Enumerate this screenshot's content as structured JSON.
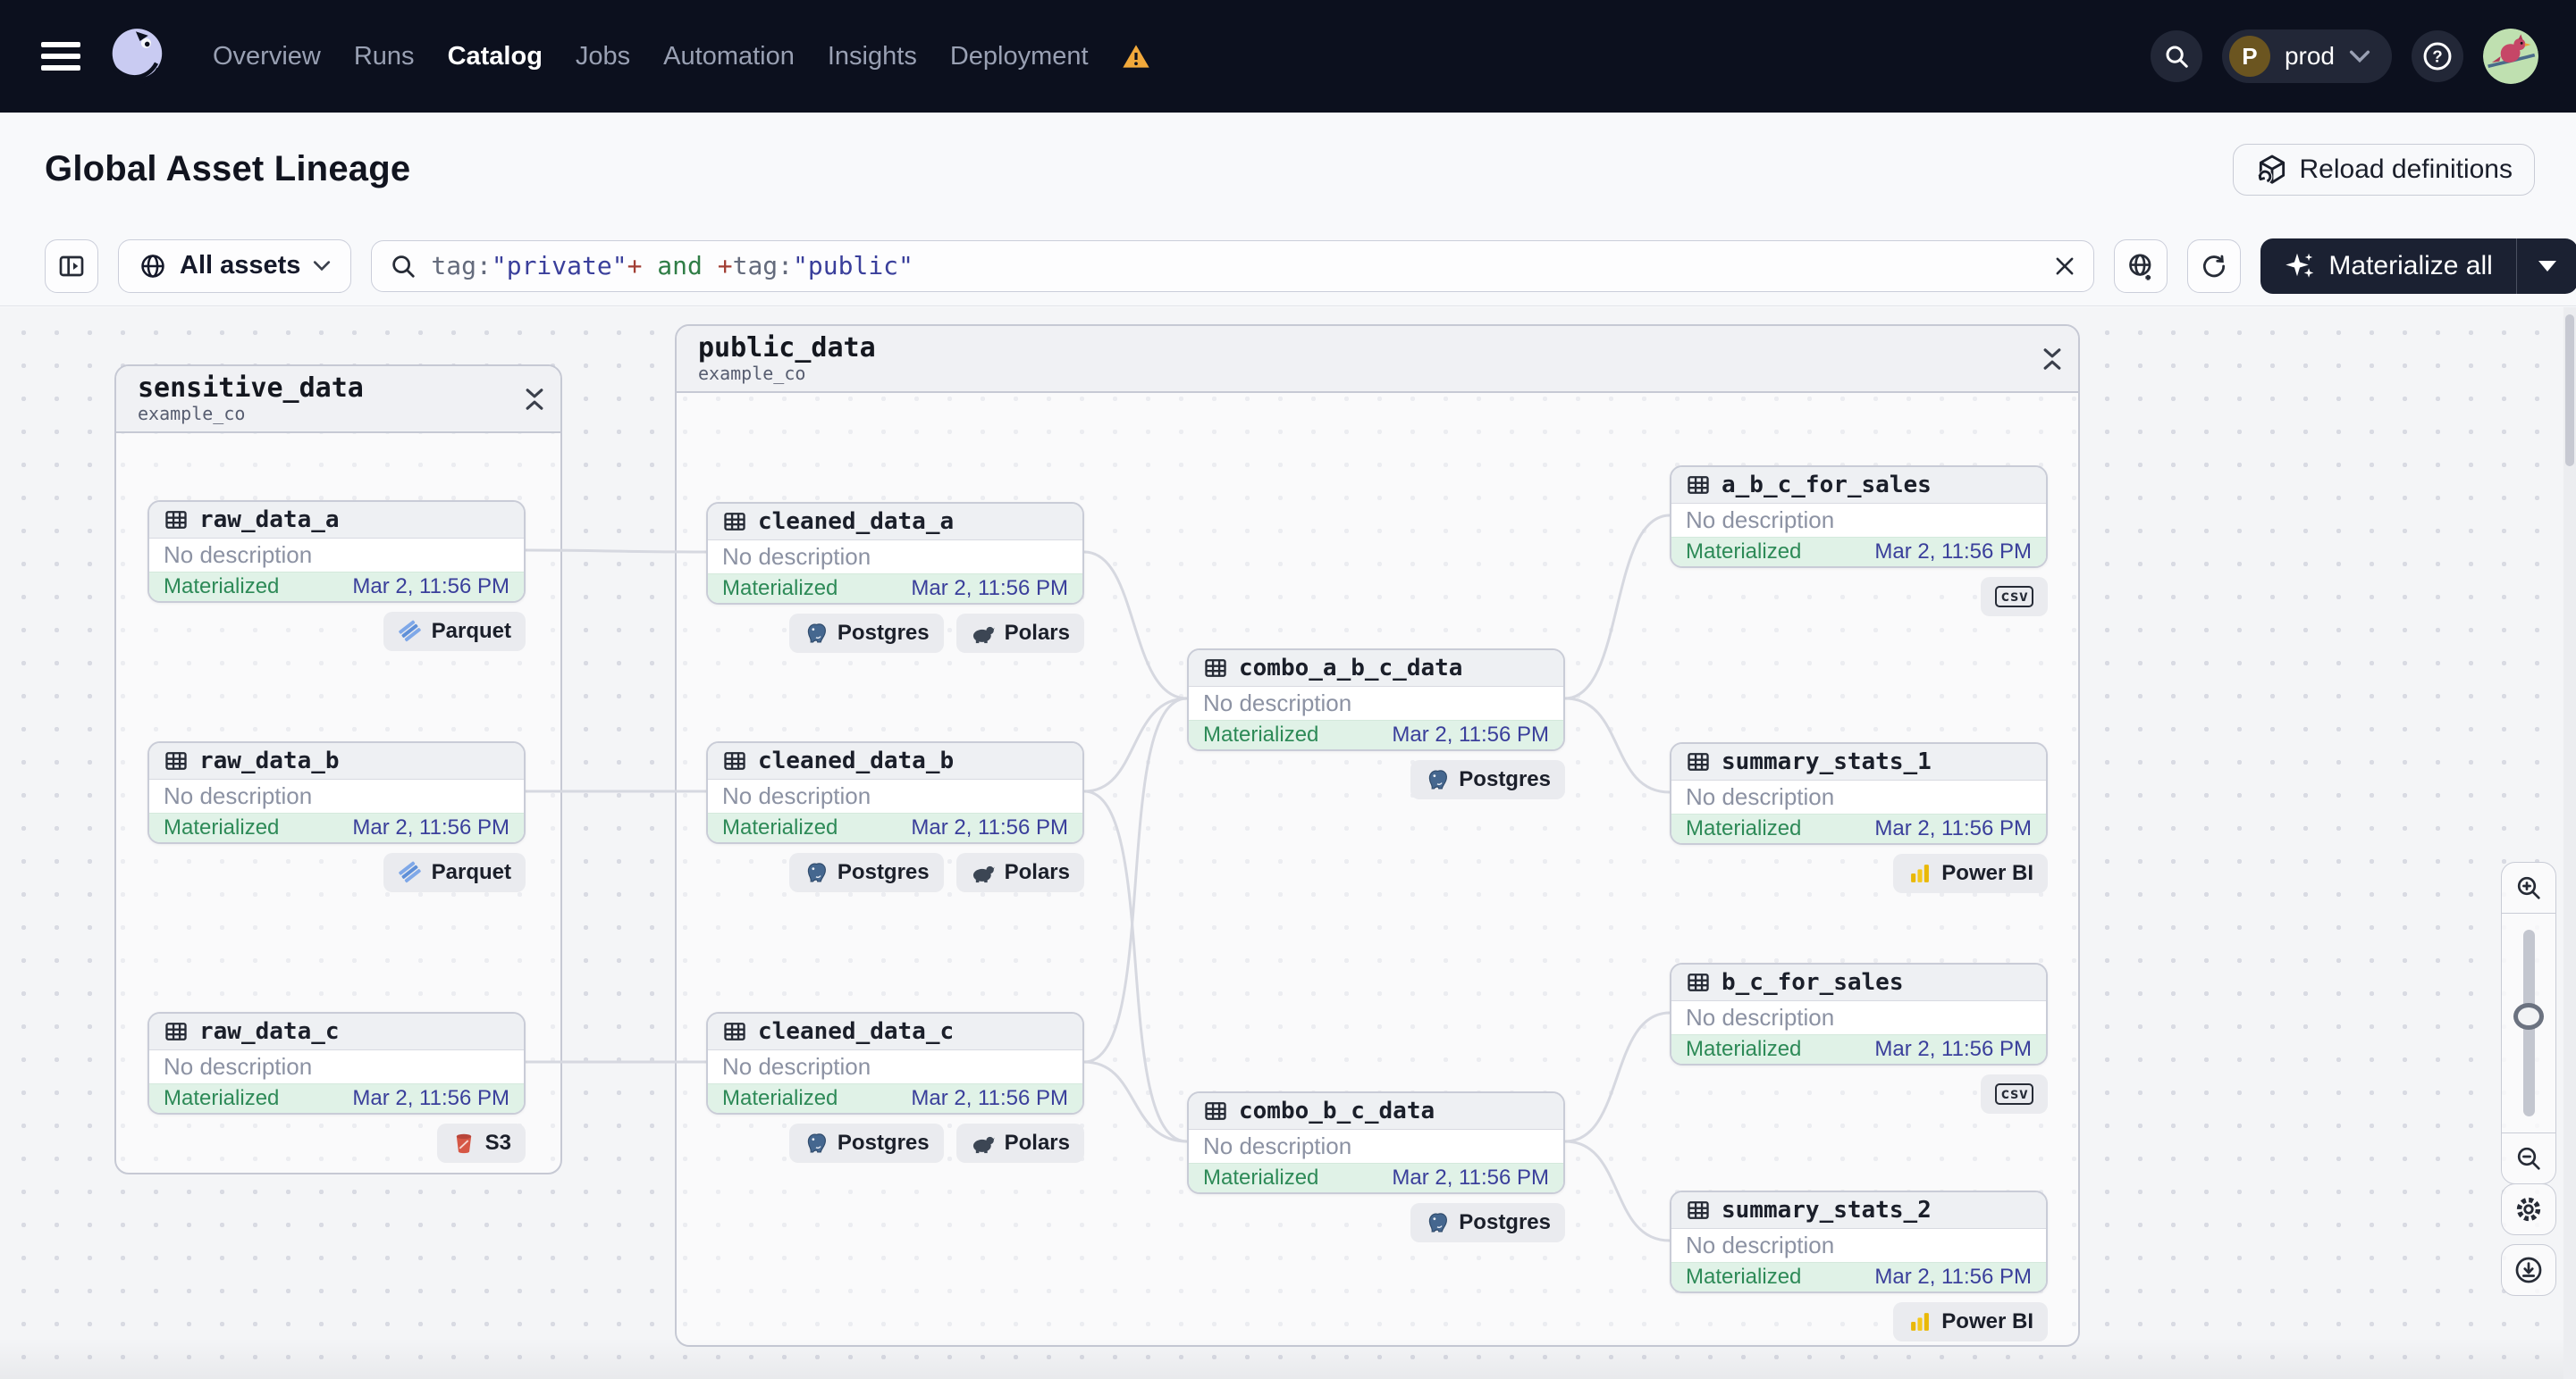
{
  "topnav": {
    "items": [
      "Overview",
      "Runs",
      "Catalog",
      "Jobs",
      "Automation",
      "Insights",
      "Deployment"
    ],
    "active_item": "Catalog",
    "deployment_has_warning": true,
    "environment": {
      "initial": "P",
      "name": "prod"
    }
  },
  "header": {
    "title": "Global Asset Lineage",
    "reload_button": "Reload definitions"
  },
  "toolbar": {
    "scope_label": "All assets",
    "query": [
      {
        "text": "tag:",
        "color": "#646B7C"
      },
      {
        "text": "\"private\"",
        "color": "#3A3F9B"
      },
      {
        "text": "+",
        "color": "#A13D33"
      },
      {
        "text": " and ",
        "color": "#2F7D46"
      },
      {
        "text": "+",
        "color": "#A13D33"
      },
      {
        "text": "tag:",
        "color": "#646B7C"
      },
      {
        "text": "\"public\"",
        "color": "#3A3F9B"
      }
    ],
    "materialize_label": "Materialize all"
  },
  "graph": {
    "groups": [
      {
        "name": "sensitive_data",
        "repo": "example_co"
      },
      {
        "name": "public_data",
        "repo": "example_co"
      }
    ],
    "nodes": [
      {
        "name": "raw_data_a",
        "description": "No description",
        "status": "Materialized",
        "timestamp": "Mar 2, 11:56 PM",
        "badges": [
          "Parquet"
        ]
      },
      {
        "name": "raw_data_b",
        "description": "No description",
        "status": "Materialized",
        "timestamp": "Mar 2, 11:56 PM",
        "badges": [
          "Parquet"
        ]
      },
      {
        "name": "raw_data_c",
        "description": "No description",
        "status": "Materialized",
        "timestamp": "Mar 2, 11:56 PM",
        "badges": [
          "S3"
        ]
      },
      {
        "name": "cleaned_data_a",
        "description": "No description",
        "status": "Materialized",
        "timestamp": "Mar 2, 11:56 PM",
        "badges": [
          "Postgres",
          "Polars"
        ]
      },
      {
        "name": "cleaned_data_b",
        "description": "No description",
        "status": "Materialized",
        "timestamp": "Mar 2, 11:56 PM",
        "badges": [
          "Postgres",
          "Polars"
        ]
      },
      {
        "name": "cleaned_data_c",
        "description": "No description",
        "status": "Materialized",
        "timestamp": "Mar 2, 11:56 PM",
        "badges": [
          "Postgres",
          "Polars"
        ]
      },
      {
        "name": "combo_a_b_c_data",
        "description": "No description",
        "status": "Materialized",
        "timestamp": "Mar 2, 11:56 PM",
        "badges": [
          "Postgres"
        ]
      },
      {
        "name": "combo_b_c_data",
        "description": "No description",
        "status": "Materialized",
        "timestamp": "Mar 2, 11:56 PM",
        "badges": [
          "Postgres"
        ]
      },
      {
        "name": "a_b_c_for_sales",
        "description": "No description",
        "status": "Materialized",
        "timestamp": "Mar 2, 11:56 PM",
        "badges": [
          "csv"
        ]
      },
      {
        "name": "summary_stats_1",
        "description": "No description",
        "status": "Materialized",
        "timestamp": "Mar 2, 11:56 PM",
        "badges": [
          "Power BI"
        ]
      },
      {
        "name": "b_c_for_sales",
        "description": "No description",
        "status": "Materialized",
        "timestamp": "Mar 2, 11:56 PM",
        "badges": [
          "csv"
        ]
      },
      {
        "name": "summary_stats_2",
        "description": "No description",
        "status": "Materialized",
        "timestamp": "Mar 2, 11:56 PM",
        "badges": [
          "Power BI"
        ]
      }
    ]
  },
  "icons": [
    "menu",
    "dagster-logo",
    "warning-triangle",
    "search",
    "chevron-down",
    "help",
    "reload-cube",
    "panel-toggle",
    "globe",
    "clear-x",
    "globe-add",
    "refresh",
    "sparkles",
    "table",
    "parquet",
    "s3-bucket",
    "postgres",
    "polars",
    "power-bi",
    "csv",
    "collapse-chevrons",
    "zoom-in",
    "zoom-out",
    "gear",
    "download"
  ],
  "colors": {
    "accent_dark": "#1B2132",
    "status_green": "#2D8A57",
    "timestamp_indigo": "#3A3F9B",
    "warning_orange": "#F2A93B"
  }
}
